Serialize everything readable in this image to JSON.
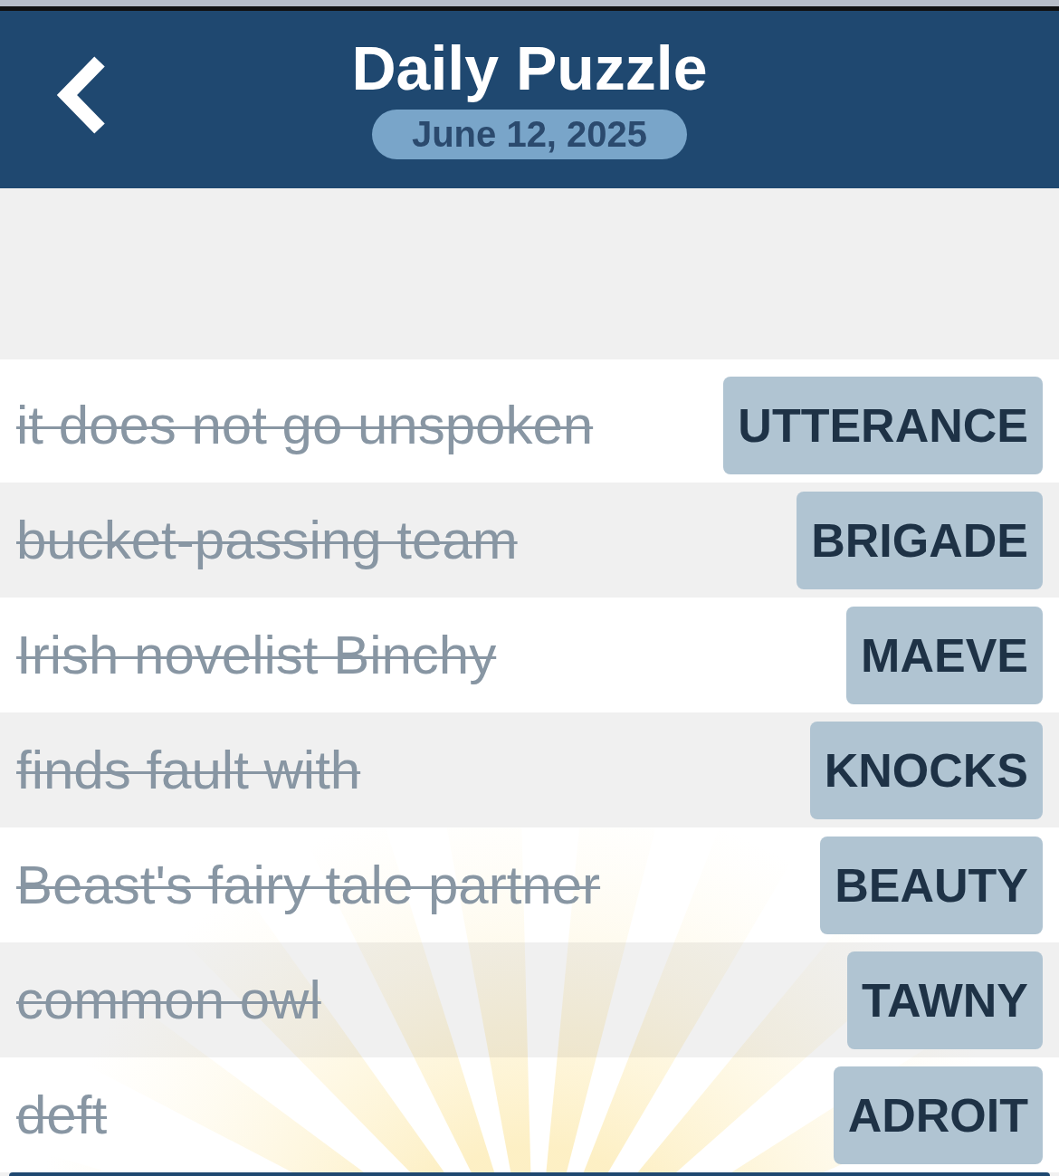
{
  "header": {
    "title": "Daily Puzzle",
    "date": "June 12, 2025"
  },
  "clues": [
    {
      "clue": "it does not go unspoken",
      "answer": "UTTERANCE",
      "solved": true
    },
    {
      "clue": "bucket-passing team",
      "answer": "BRIGADE",
      "solved": true
    },
    {
      "clue": "Irish novelist Binchy",
      "answer": "MAEVE",
      "solved": true
    },
    {
      "clue": "finds fault with",
      "answer": "KNOCKS",
      "solved": true
    },
    {
      "clue": "Beast's fairy tale partner",
      "answer": "BEAUTY",
      "solved": true
    },
    {
      "clue": "common owl",
      "answer": "TAWNY",
      "solved": true
    },
    {
      "clue": "deft",
      "answer": "ADROIT",
      "solved": true
    }
  ]
}
